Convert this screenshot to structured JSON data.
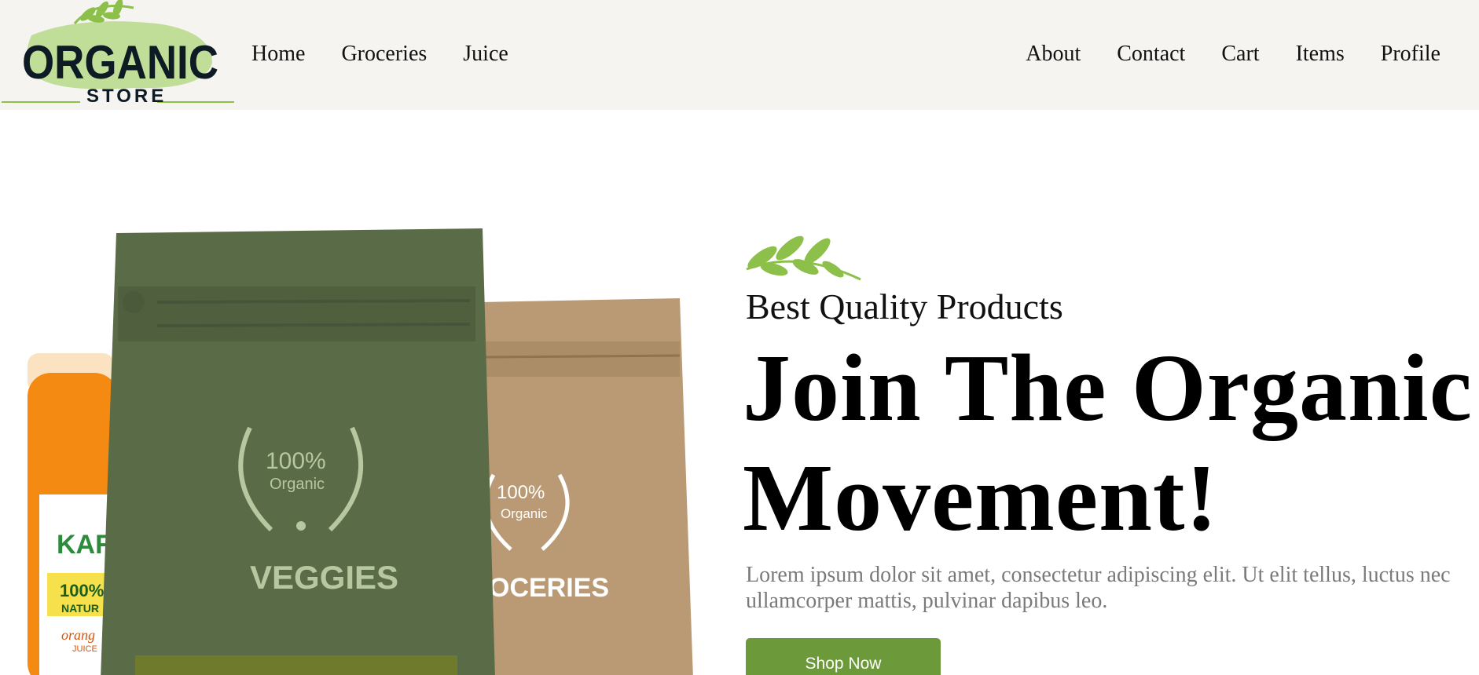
{
  "header": {
    "logo": {
      "word1": "ORGANIC",
      "word2": "STORE"
    },
    "nav_left": [
      {
        "label": "Home"
      },
      {
        "label": "Groceries"
      },
      {
        "label": "Juice"
      }
    ],
    "nav_right": [
      {
        "label": "About"
      },
      {
        "label": "Contact"
      },
      {
        "label": "Cart"
      },
      {
        "label": "Items"
      },
      {
        "label": "Profile"
      }
    ]
  },
  "hero": {
    "product_image": {
      "bag_green": {
        "badge_percent": "100%",
        "badge_word": "Organic",
        "label": "VEGGIES"
      },
      "bag_kraft": {
        "badge_percent": "100%",
        "badge_word": "Organic",
        "label": "OCERIES"
      },
      "jar": {
        "brand": "KARI",
        "badge": "100%",
        "badge2": "NATUR",
        "flavor": "orang",
        "flavor2": "JUICE"
      }
    },
    "subtitle": "Best Quality Products",
    "title": "Join The Organic Movement!",
    "description": "Lorem ipsum dolor sit amet, consectetur adipiscing elit. Ut elit tellus, luctus nec ullamcorper mattis, pulvinar dapibus leo.",
    "cta_label": "Shop Now"
  },
  "colors": {
    "header_bg": "#f5f4f1",
    "accent_green": "#6c9a3a",
    "leaf_green": "#8cc04a",
    "bag_green": "#5a6b47",
    "bag_kraft": "#b99a74",
    "jar_orange": "#f58a12",
    "text_muted": "#7a7a7a"
  },
  "icons": [
    "leaf-sprig-icon",
    "leaf-sprig-logo-icon"
  ]
}
